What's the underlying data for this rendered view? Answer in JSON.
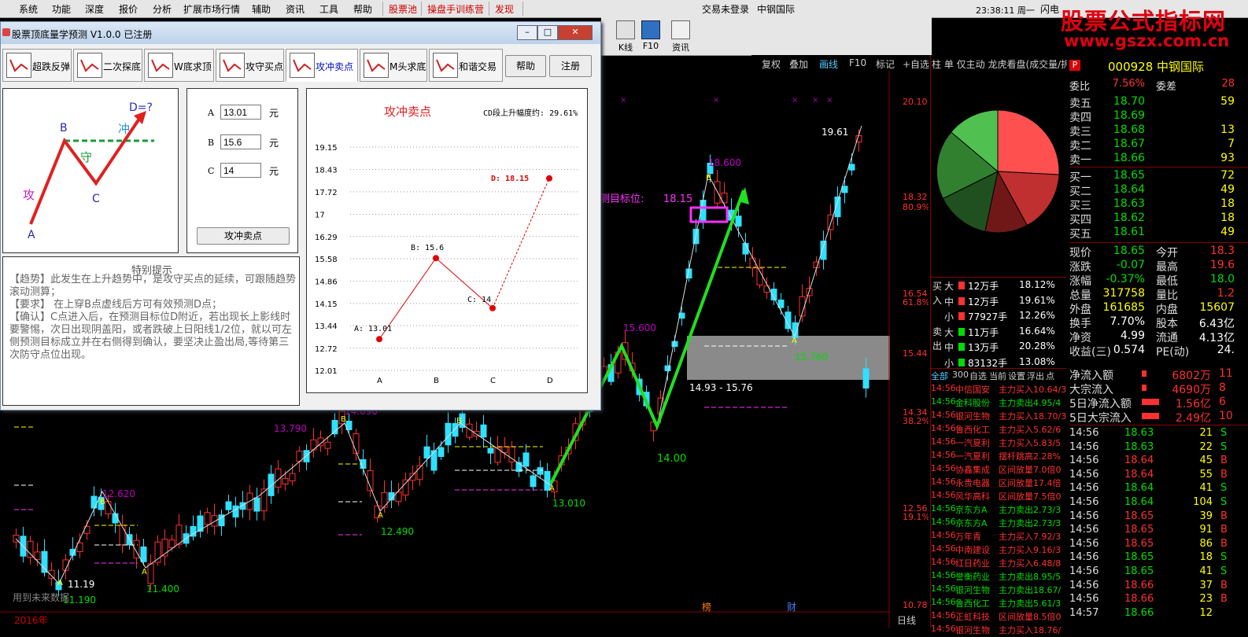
{
  "menu": {
    "items": [
      "系统",
      "功能",
      "深度",
      "报价",
      "分析",
      "扩展市场行情",
      "辅助",
      "资讯",
      "工具",
      "帮助"
    ],
    "red_items": [
      "股票池",
      "操盘手训练营",
      "发现"
    ],
    "center_text": "交易未登录",
    "stock_name": "中钢国际",
    "clock": "23:38:11 周一",
    "right_text": "闪电"
  },
  "watermark": {
    "line1": "股票公式指标网",
    "line2": "www.gszx.com.cn"
  },
  "toolbar": {
    "items": [
      "K线",
      "F10",
      "资讯"
    ]
  },
  "chart_toolbar": {
    "items": [
      "复权",
      "叠加",
      "画线",
      "F10",
      "标记",
      "+自选"
    ]
  },
  "right_header": {
    "text": "柱 单 仅主动 龙虎看盘(成交量/拆"
  },
  "quote": {
    "badge": "P",
    "code_name": "000928 中钢国际",
    "weibi_label": "委比",
    "weibi": "7.56%",
    "weicha_label": "委差",
    "weicha": "28",
    "asks": [
      {
        "label": "卖五",
        "price": "18.70",
        "vol": "59"
      },
      {
        "label": "卖四",
        "price": "18.69",
        "vol": ""
      },
      {
        "label": "卖三",
        "price": "18.68",
        "vol": "13"
      },
      {
        "label": "卖二",
        "price": "18.67",
        "vol": "7"
      },
      {
        "label": "卖一",
        "price": "18.66",
        "vol": "93"
      }
    ],
    "bids": [
      {
        "label": "买一",
        "price": "18.65",
        "vol": "72"
      },
      {
        "label": "买二",
        "price": "18.64",
        "vol": "49"
      },
      {
        "label": "买三",
        "price": "18.63",
        "vol": "18"
      },
      {
        "label": "买四",
        "price": "18.62",
        "vol": "18"
      },
      {
        "label": "买五",
        "price": "18.61",
        "vol": "49"
      }
    ],
    "stats": [
      {
        "l": "现价",
        "v": "18.65",
        "vc": "#00dd00",
        "l2": "今开",
        "v2": "18.3",
        "v2c": "#ff3030"
      },
      {
        "l": "涨跌",
        "v": "-0.07",
        "vc": "#00dd00",
        "l2": "最高",
        "v2": "19.6",
        "v2c": "#ff3030"
      },
      {
        "l": "涨幅",
        "v": "-0.37%",
        "vc": "#00dd00",
        "l2": "最低",
        "v2": "18.0",
        "v2c": "#00dd00"
      },
      {
        "l": "总量",
        "v": "317758",
        "vc": "#ffff00",
        "l2": "量比",
        "v2": "1.2",
        "v2c": "#ff3030"
      },
      {
        "l": "外盘",
        "v": "161685",
        "vc": "#ffff00",
        "l2": "内盘",
        "v2": "15607",
        "v2c": "#ffff00"
      },
      {
        "l": "换手",
        "v": "7.70%",
        "vc": "#ffffff",
        "l2": "股本",
        "v2": "6.43亿",
        "v2c": "#ffffff"
      },
      {
        "l": "净资",
        "v": "4.99",
        "vc": "#ffffff",
        "l2": "流通",
        "v2": "4.13亿",
        "v2c": "#ffffff"
      },
      {
        "l": "收益(三)",
        "v": "0.574",
        "vc": "#ffffff",
        "l2": "PE(动)",
        "v2": "24.",
        "v2c": "#ffffff"
      }
    ]
  },
  "flow": {
    "buy_label": "买入",
    "sell_label": "卖出",
    "rows": [
      {
        "k": "大",
        "v": "12万手",
        "p": "18.12%",
        "side": "buy"
      },
      {
        "k": "中",
        "v": "12万手",
        "p": "19.61%",
        "side": "buy"
      },
      {
        "k": "小",
        "v": "77927手",
        "p": "12.26%",
        "side": "buy"
      },
      {
        "k": "大",
        "v": "11万手",
        "p": "16.64%",
        "side": "sell"
      },
      {
        "k": "中",
        "v": "13万手",
        "p": "20.28%",
        "side": "sell"
      },
      {
        "k": "小",
        "v": "83132手",
        "p": "13.08%",
        "side": "sell"
      }
    ]
  },
  "tick_header": [
    "全部",
    "300",
    "自选",
    "当前",
    "设置",
    "浮出",
    "点"
  ],
  "ticks": [
    {
      "t": "14:56",
      "n": "中信国安",
      "a": "主力买入10.64/3"
    },
    {
      "t": "14:56",
      "n": "金科股份",
      "a": "主力卖出4.95/4"
    },
    {
      "t": "14:56",
      "n": "银河生物",
      "a": "主力买入18.70/3"
    },
    {
      "t": "14:56",
      "n": "鲁西化工",
      "a": "主力买入5.62/6"
    },
    {
      "t": "14:56",
      "n": "一汽夏利",
      "a": "主力买入5.83/5"
    },
    {
      "t": "14:56",
      "n": "一汽夏利",
      "a": "摆杆跳高2.28%"
    },
    {
      "t": "14:56",
      "n": "协鑫集成",
      "a": "区间放量7.0倍0"
    },
    {
      "t": "14:56",
      "n": "永贵电器",
      "a": "区间放量17.4倍"
    },
    {
      "t": "14:56",
      "n": "风华高科",
      "a": "区间放量7.5倍0"
    },
    {
      "t": "14:56",
      "n": "京东方A",
      "a": "主力卖出2.73/3"
    },
    {
      "t": "14:56",
      "n": "京东方A",
      "a": "主力卖出2.73/3"
    },
    {
      "t": "14:56",
      "n": "万年青",
      "a": "主力买入7.92/3"
    },
    {
      "t": "14:56",
      "n": "中南建设",
      "a": "主力买入9.16/3"
    },
    {
      "t": "14:56",
      "n": "红日药业",
      "a": "主力买入6.48/8"
    },
    {
      "t": "14:56",
      "n": "誉衡药业",
      "a": "主力卖出8.95/5"
    },
    {
      "t": "14:56",
      "n": "银河生物",
      "a": "主力卖出18.67/"
    },
    {
      "t": "14:56",
      "n": "鲁西化工",
      "a": "主力卖出5.61/3"
    },
    {
      "t": "14:56",
      "n": "正虹科技",
      "a": "区间放量8.5倍0"
    },
    {
      "t": "14:56",
      "n": "银河生物",
      "a": "主力买入18.76/"
    }
  ],
  "netflow": [
    {
      "l": "净流入额",
      "v": "6802万",
      "v2": "11"
    },
    {
      "l": "大宗流入",
      "v": "4690万",
      "v2": "8"
    },
    {
      "l": "5日净流入额",
      "v": "1.56亿",
      "v2": "6"
    },
    {
      "l": "5日大宗流入",
      "v": "2.49亿",
      "v2": "10"
    }
  ],
  "deals": [
    {
      "t": "14:56",
      "p": "18.63",
      "v": "21",
      "s": "S",
      "sc": "#00dd00"
    },
    {
      "t": "14:56",
      "p": "18.63",
      "v": "22",
      "s": "S",
      "sc": "#00dd00"
    },
    {
      "t": "14:56",
      "p": "18.64",
      "v": "45",
      "s": "B",
      "sc": "#ff3030"
    },
    {
      "t": "14:56",
      "p": "18.64",
      "v": "55",
      "s": "B",
      "sc": "#ff3030"
    },
    {
      "t": "14:56",
      "p": "18.64",
      "v": "41",
      "s": "S",
      "sc": "#00dd00"
    },
    {
      "t": "14:56",
      "p": "18.64",
      "v": "104",
      "s": "S",
      "sc": "#00dd00"
    },
    {
      "t": "14:56",
      "p": "18.65",
      "v": "39",
      "s": "B",
      "sc": "#ff3030"
    },
    {
      "t": "14:56",
      "p": "18.65",
      "v": "91",
      "s": "B",
      "sc": "#ff3030"
    },
    {
      "t": "14:56",
      "p": "18.65",
      "v": "86",
      "s": "B",
      "sc": "#ff3030"
    },
    {
      "t": "14:56",
      "p": "18.65",
      "v": "18",
      "s": "S",
      "sc": "#00dd00"
    },
    {
      "t": "14:56",
      "p": "18.65",
      "v": "41",
      "s": "S",
      "sc": "#00dd00"
    },
    {
      "t": "14:56",
      "p": "18.66",
      "v": "37",
      "s": "B",
      "sc": "#ff3030"
    },
    {
      "t": "14:56",
      "p": "18.66",
      "v": "23",
      "s": "B",
      "sc": "#ff3030"
    },
    {
      "t": "14:57",
      "p": "18.66",
      "v": "12",
      "s": "",
      "sc": "#00dd00"
    }
  ],
  "main_chart": {
    "price_axis": [
      "20.10",
      "18.32",
      "16.54",
      "15.44",
      "14.34",
      "12.56",
      "10.78"
    ],
    "pct_axis": [
      "80.9%",
      "61.8%",
      "38.2%",
      "19.1%"
    ],
    "labels": {
      "p1": "11.19",
      "p2": "12.620",
      "p3": "11.400",
      "p4": "13.790",
      "p5": "14.090",
      "p6": "12.490",
      "p7": "13.010",
      "p8": "15.600",
      "p9": "14.00",
      "p10": "18.600",
      "p11": "15.760",
      "p12": "19.61",
      "p13": "14.93 - 15.76",
      "p14": "11.190",
      "target_label": "测目标位:",
      "target_value": "18.15",
      "future_note": "用到未来数据",
      "marker_bang": "榜",
      "marker_cai": "财",
      "date_label": "日线",
      "year_label": "2016年"
    }
  },
  "dialog": {
    "title": "股票顶底量学预测 V1.0.0  已注册",
    "tabs": [
      "超跌反弹",
      "二次探底",
      "W底求顶",
      "攻守买点",
      "攻冲卖点",
      "M头求底",
      "和谐交易"
    ],
    "help_btn": "帮助",
    "reg_btn": "注册",
    "diagram": {
      "A": "A",
      "B": "B",
      "C": "C",
      "D": "D=?",
      "gong": "攻",
      "shou": "守",
      "chong": "冲"
    },
    "inputs": [
      {
        "label": "A",
        "value": "13.01",
        "unit": "元"
      },
      {
        "label": "B",
        "value": "15.6",
        "unit": "元"
      },
      {
        "label": "C",
        "value": "14",
        "unit": "元"
      }
    ],
    "calc_btn": "攻冲卖点",
    "tips_title": "特别提示",
    "tips": [
      "【趋势】此发生在上升趋势中，是攻守买点的延续，可跟随趋势滚动测算；",
      "【要求】  在上穿B点虚线后方可有效预测D点；",
      "【确认】C点进入后，在预测目标位D附近，若出现长上影线时要警惕，次日出现阴盖阳，或者跌破上日阳线1/2位，就以可左侧预测目标成立并在右侧得到确认，要坚决止盈出局,等待第三次防守点位出现。"
    ]
  },
  "chart_data": {
    "type": "line",
    "title": "攻冲卖点",
    "subtitle": "CD段上升幅度约: 29.61%",
    "categories": [
      "A",
      "B",
      "C",
      "D"
    ],
    "values": [
      13.01,
      15.6,
      14,
      18.15
    ],
    "point_labels": [
      "A: 13.01",
      "B: 15.6",
      "C: 14",
      "D: 18.15"
    ],
    "y_ticks": [
      "12.01",
      "12.72",
      "13.44",
      "14.15",
      "14.86",
      "15.58",
      "16.29",
      "17",
      "17.72",
      "18.43",
      "19.15"
    ],
    "ylim": [
      12.01,
      19.15
    ],
    "grid": true,
    "colors": {
      "line": "#e00000",
      "dashed": "#e00000"
    }
  }
}
